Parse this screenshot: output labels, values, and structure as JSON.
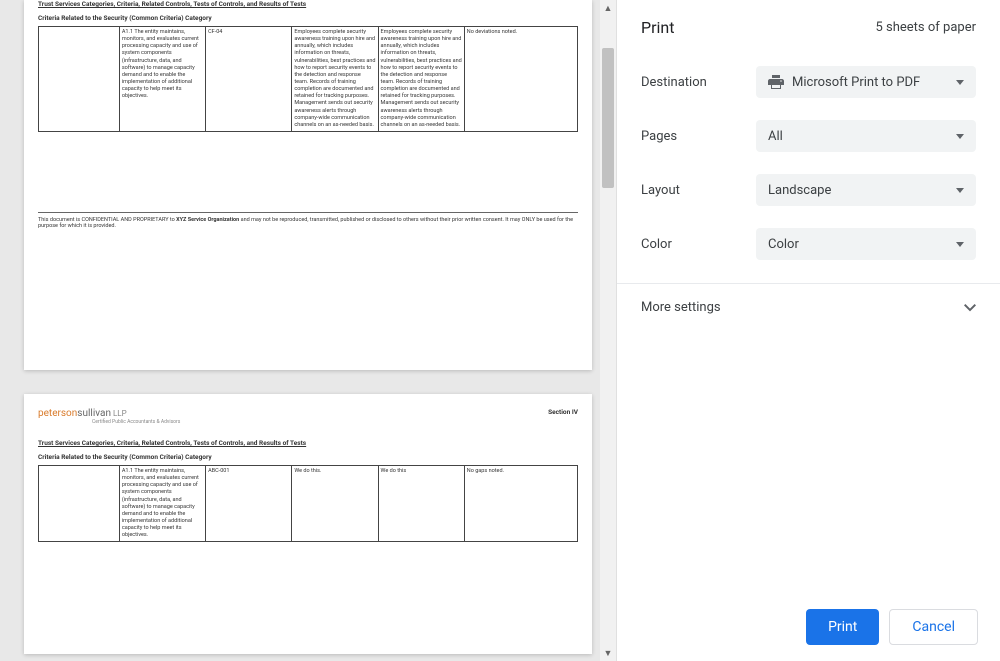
{
  "preview": {
    "page1": {
      "heading": "Trust Services Categories, Criteria, Related Controls, Tests of Controls, and Results of Tests",
      "subheading": "Criteria Related to the Security (Common Criteria) Category",
      "table": {
        "col1": "",
        "col2": "A1.1 The entity maintains, monitors, and evaluates current processing capacity and use of system components (infrastructure, data, and software) to manage capacity demand and to enable the implementation of additional capacity to help meet its objectives.",
        "col3": "CF-04",
        "col4": "Employees complete security awareness training upon hire and annually, which includes information on threats, vulnerabilities, best practices and how to report security events to the detection and response team. Records of training completion are documented and retained for tracking purposes. Management sends out security awareness alerts through company-wide communication channels on an as-needed basis.",
        "col5": "Employees complete security awareness training upon hire and annually, which includes information on threats, vulnerabilities, best practices and how to report security events to the detection and response team. Records of training completion are documented and retained for tracking purposes. Management sends out security awareness alerts through company-wide communication channels on an as-needed basis.",
        "col6": "No deviations noted."
      },
      "footer_prefix": "This document is ",
      "footer_confidential": "CONFIDENTIAL AND PROPRIETARY",
      "footer_mid": " to ",
      "footer_org": "XYZ Service Organization",
      "footer_rest": " and may not be reproduced, transmitted, published or disclosed to others without their prior written consent. It may ONLY be used for the purpose for which it is provided."
    },
    "page2": {
      "logo": {
        "part1": "peterson",
        "part2": "sullivan",
        "part3": " LLP",
        "sub": "Certified Public Accountants & Advisors"
      },
      "section": "Section IV",
      "heading": "Trust Services Categories, Criteria, Related Controls, Tests of Controls, and Results of Tests",
      "subheading": "Criteria Related to the Security (Common Criteria) Category",
      "table": {
        "col1": "",
        "col2": "A1.1 The entity maintains, monitors, and evaluates current processing capacity and use of system components (infrastructure, data, and software) to manage capacity demand and to enable the implementation of additional capacity to help meet its objectives.",
        "col3": "ABC-001",
        "col4": "We do this.",
        "col5": "We do this",
        "col6": "No gaps noted."
      }
    }
  },
  "panel": {
    "title": "Print",
    "sheets": "5 sheets of paper",
    "destination_label": "Destination",
    "destination_value": "Microsoft Print to PDF",
    "pages_label": "Pages",
    "pages_value": "All",
    "layout_label": "Layout",
    "layout_value": "Landscape",
    "color_label": "Color",
    "color_value": "Color",
    "more_settings": "More settings",
    "print_btn": "Print",
    "cancel_btn": "Cancel"
  }
}
